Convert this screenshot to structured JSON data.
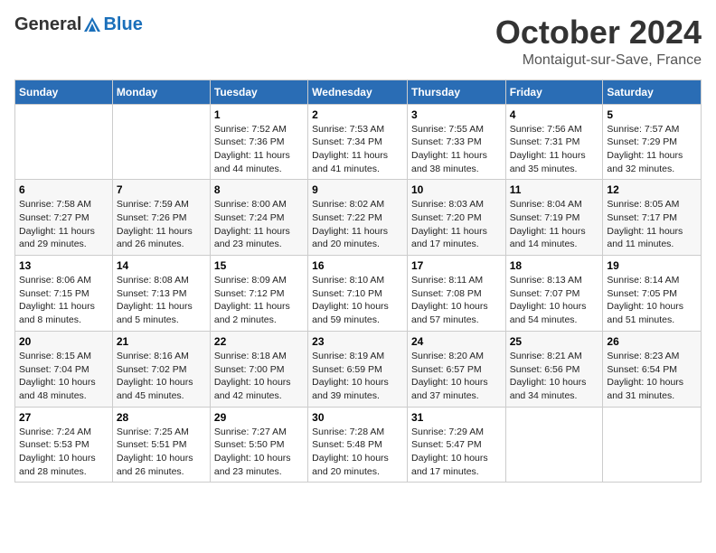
{
  "header": {
    "logo_general": "General",
    "logo_blue": "Blue",
    "month_title": "October 2024",
    "location": "Montaigut-sur-Save, France"
  },
  "columns": [
    "Sunday",
    "Monday",
    "Tuesday",
    "Wednesday",
    "Thursday",
    "Friday",
    "Saturday"
  ],
  "weeks": [
    [
      {
        "day": "",
        "sunrise": "",
        "sunset": "",
        "daylight": ""
      },
      {
        "day": "",
        "sunrise": "",
        "sunset": "",
        "daylight": ""
      },
      {
        "day": "1",
        "sunrise": "Sunrise: 7:52 AM",
        "sunset": "Sunset: 7:36 PM",
        "daylight": "Daylight: 11 hours and 44 minutes."
      },
      {
        "day": "2",
        "sunrise": "Sunrise: 7:53 AM",
        "sunset": "Sunset: 7:34 PM",
        "daylight": "Daylight: 11 hours and 41 minutes."
      },
      {
        "day": "3",
        "sunrise": "Sunrise: 7:55 AM",
        "sunset": "Sunset: 7:33 PM",
        "daylight": "Daylight: 11 hours and 38 minutes."
      },
      {
        "day": "4",
        "sunrise": "Sunrise: 7:56 AM",
        "sunset": "Sunset: 7:31 PM",
        "daylight": "Daylight: 11 hours and 35 minutes."
      },
      {
        "day": "5",
        "sunrise": "Sunrise: 7:57 AM",
        "sunset": "Sunset: 7:29 PM",
        "daylight": "Daylight: 11 hours and 32 minutes."
      }
    ],
    [
      {
        "day": "6",
        "sunrise": "Sunrise: 7:58 AM",
        "sunset": "Sunset: 7:27 PM",
        "daylight": "Daylight: 11 hours and 29 minutes."
      },
      {
        "day": "7",
        "sunrise": "Sunrise: 7:59 AM",
        "sunset": "Sunset: 7:26 PM",
        "daylight": "Daylight: 11 hours and 26 minutes."
      },
      {
        "day": "8",
        "sunrise": "Sunrise: 8:00 AM",
        "sunset": "Sunset: 7:24 PM",
        "daylight": "Daylight: 11 hours and 23 minutes."
      },
      {
        "day": "9",
        "sunrise": "Sunrise: 8:02 AM",
        "sunset": "Sunset: 7:22 PM",
        "daylight": "Daylight: 11 hours and 20 minutes."
      },
      {
        "day": "10",
        "sunrise": "Sunrise: 8:03 AM",
        "sunset": "Sunset: 7:20 PM",
        "daylight": "Daylight: 11 hours and 17 minutes."
      },
      {
        "day": "11",
        "sunrise": "Sunrise: 8:04 AM",
        "sunset": "Sunset: 7:19 PM",
        "daylight": "Daylight: 11 hours and 14 minutes."
      },
      {
        "day": "12",
        "sunrise": "Sunrise: 8:05 AM",
        "sunset": "Sunset: 7:17 PM",
        "daylight": "Daylight: 11 hours and 11 minutes."
      }
    ],
    [
      {
        "day": "13",
        "sunrise": "Sunrise: 8:06 AM",
        "sunset": "Sunset: 7:15 PM",
        "daylight": "Daylight: 11 hours and 8 minutes."
      },
      {
        "day": "14",
        "sunrise": "Sunrise: 8:08 AM",
        "sunset": "Sunset: 7:13 PM",
        "daylight": "Daylight: 11 hours and 5 minutes."
      },
      {
        "day": "15",
        "sunrise": "Sunrise: 8:09 AM",
        "sunset": "Sunset: 7:12 PM",
        "daylight": "Daylight: 11 hours and 2 minutes."
      },
      {
        "day": "16",
        "sunrise": "Sunrise: 8:10 AM",
        "sunset": "Sunset: 7:10 PM",
        "daylight": "Daylight: 10 hours and 59 minutes."
      },
      {
        "day": "17",
        "sunrise": "Sunrise: 8:11 AM",
        "sunset": "Sunset: 7:08 PM",
        "daylight": "Daylight: 10 hours and 57 minutes."
      },
      {
        "day": "18",
        "sunrise": "Sunrise: 8:13 AM",
        "sunset": "Sunset: 7:07 PM",
        "daylight": "Daylight: 10 hours and 54 minutes."
      },
      {
        "day": "19",
        "sunrise": "Sunrise: 8:14 AM",
        "sunset": "Sunset: 7:05 PM",
        "daylight": "Daylight: 10 hours and 51 minutes."
      }
    ],
    [
      {
        "day": "20",
        "sunrise": "Sunrise: 8:15 AM",
        "sunset": "Sunset: 7:04 PM",
        "daylight": "Daylight: 10 hours and 48 minutes."
      },
      {
        "day": "21",
        "sunrise": "Sunrise: 8:16 AM",
        "sunset": "Sunset: 7:02 PM",
        "daylight": "Daylight: 10 hours and 45 minutes."
      },
      {
        "day": "22",
        "sunrise": "Sunrise: 8:18 AM",
        "sunset": "Sunset: 7:00 PM",
        "daylight": "Daylight: 10 hours and 42 minutes."
      },
      {
        "day": "23",
        "sunrise": "Sunrise: 8:19 AM",
        "sunset": "Sunset: 6:59 PM",
        "daylight": "Daylight: 10 hours and 39 minutes."
      },
      {
        "day": "24",
        "sunrise": "Sunrise: 8:20 AM",
        "sunset": "Sunset: 6:57 PM",
        "daylight": "Daylight: 10 hours and 37 minutes."
      },
      {
        "day": "25",
        "sunrise": "Sunrise: 8:21 AM",
        "sunset": "Sunset: 6:56 PM",
        "daylight": "Daylight: 10 hours and 34 minutes."
      },
      {
        "day": "26",
        "sunrise": "Sunrise: 8:23 AM",
        "sunset": "Sunset: 6:54 PM",
        "daylight": "Daylight: 10 hours and 31 minutes."
      }
    ],
    [
      {
        "day": "27",
        "sunrise": "Sunrise: 7:24 AM",
        "sunset": "Sunset: 5:53 PM",
        "daylight": "Daylight: 10 hours and 28 minutes."
      },
      {
        "day": "28",
        "sunrise": "Sunrise: 7:25 AM",
        "sunset": "Sunset: 5:51 PM",
        "daylight": "Daylight: 10 hours and 26 minutes."
      },
      {
        "day": "29",
        "sunrise": "Sunrise: 7:27 AM",
        "sunset": "Sunset: 5:50 PM",
        "daylight": "Daylight: 10 hours and 23 minutes."
      },
      {
        "day": "30",
        "sunrise": "Sunrise: 7:28 AM",
        "sunset": "Sunset: 5:48 PM",
        "daylight": "Daylight: 10 hours and 20 minutes."
      },
      {
        "day": "31",
        "sunrise": "Sunrise: 7:29 AM",
        "sunset": "Sunset: 5:47 PM",
        "daylight": "Daylight: 10 hours and 17 minutes."
      },
      {
        "day": "",
        "sunrise": "",
        "sunset": "",
        "daylight": ""
      },
      {
        "day": "",
        "sunrise": "",
        "sunset": "",
        "daylight": ""
      }
    ]
  ]
}
